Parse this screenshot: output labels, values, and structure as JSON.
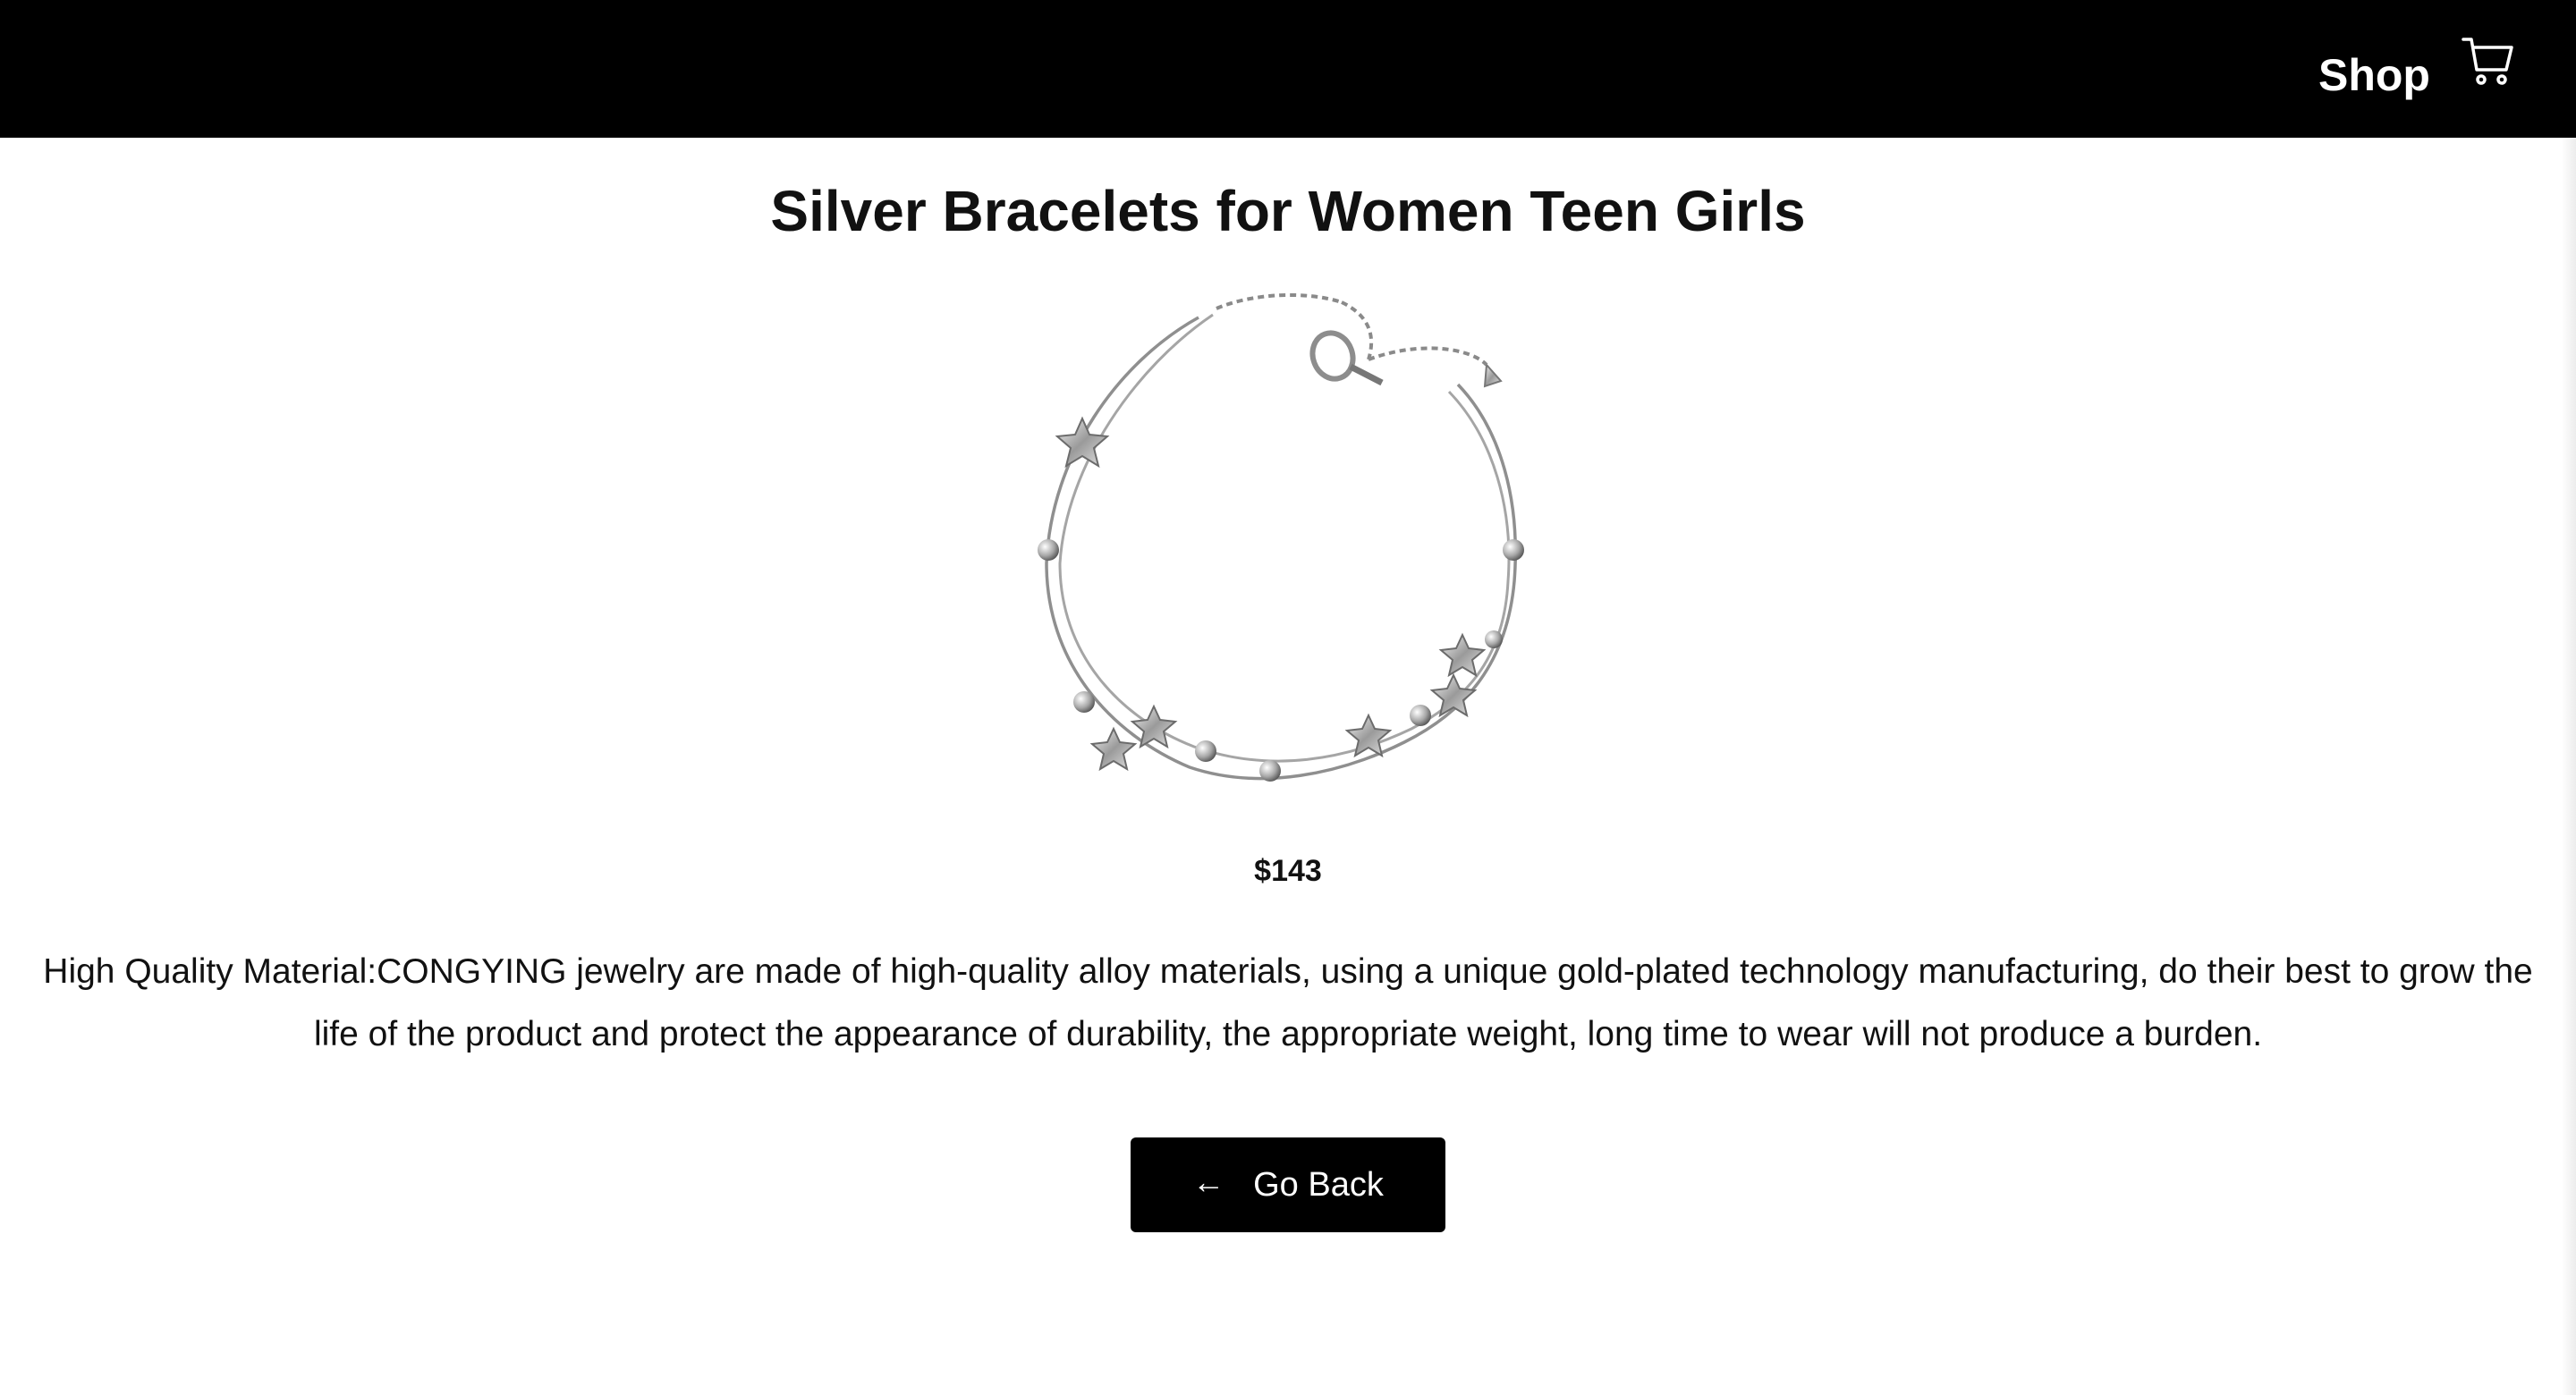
{
  "header": {
    "brand": "Shop",
    "cart_icon": "cart-icon",
    "background": "#000000",
    "text_color": "#ffffff"
  },
  "product": {
    "title": "Silver Bracelets for Women Teen Girls",
    "image_alt": "Silver double-chain bracelet with star charms",
    "price": "$143",
    "description": "High Quality Material:CONGYING jewelry are made of high-quality alloy materials, using a unique gold-plated technology manufacturing, do their best to grow the life of the product and protect the appearance of durability, the appropriate weight, long time to wear will not produce a burden."
  },
  "actions": {
    "go_back_label": "Go Back",
    "go_back_icon": "arrow-left-icon",
    "go_back_arrow": "←"
  }
}
